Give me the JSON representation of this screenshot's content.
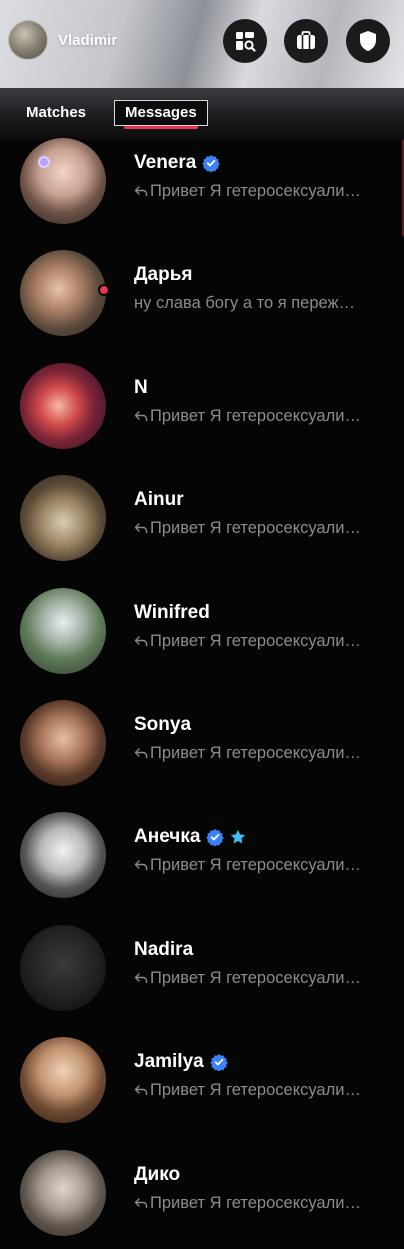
{
  "header": {
    "user_name": "Vladimir",
    "buttons": [
      {
        "icon": "explore-icon"
      },
      {
        "icon": "passport-icon"
      },
      {
        "icon": "shield-icon"
      }
    ]
  },
  "tabs": {
    "matches": "Matches",
    "messages": "Messages",
    "active": "messages",
    "active_color": "#e8344d"
  },
  "verified_color": "#3b82f6",
  "super_like_color": "#3ec0f2",
  "online_color": "#e8344d",
  "messages": [
    {
      "name": "Venera",
      "verified": true,
      "replied": true,
      "preview": "Привет Я гетеросексуали…"
    },
    {
      "name": "Дарья",
      "online": true,
      "replied": false,
      "preview": "ну слава богу а то я переж…"
    },
    {
      "name": "N",
      "replied": true,
      "preview": "Привет Я гетеросексуали…"
    },
    {
      "name": "Ainur",
      "replied": true,
      "preview": "Привет Я гетеросексуали…"
    },
    {
      "name": "Winifred",
      "replied": true,
      "preview": "Привет Я гетеросексуали…"
    },
    {
      "name": "Sonya",
      "replied": true,
      "preview": "Привет Я гетеросексуали…"
    },
    {
      "name": "Анечка",
      "verified": true,
      "super_like": true,
      "replied": true,
      "preview": "Привет Я гетеросексуали…"
    },
    {
      "name": "Nadira",
      "replied": true,
      "preview": "Привет Я гетеросексуали…"
    },
    {
      "name": "Jamilya",
      "verified": true,
      "replied": true,
      "preview": "Привет Я гетеросексуали…"
    },
    {
      "name": "Дико",
      "replied": true,
      "preview": "Привет Я гетеросексуали…"
    }
  ]
}
